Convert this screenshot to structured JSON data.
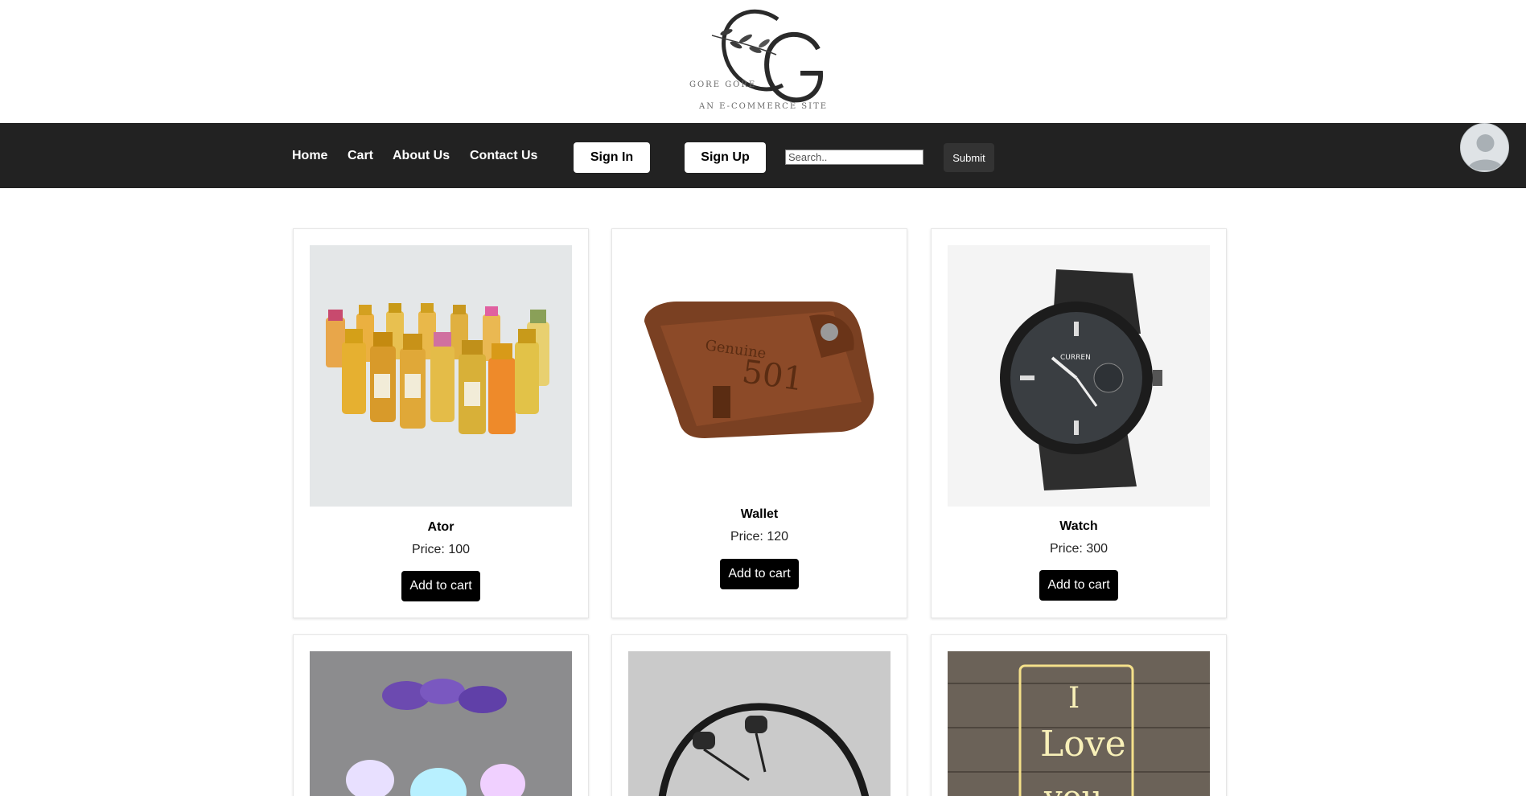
{
  "logo": {
    "brand_text": "GORE GORE",
    "tagline": "AN  E-COMMERCE SITE"
  },
  "nav": {
    "links": [
      "Home",
      "Cart",
      "About Us",
      "Contact Us"
    ],
    "sign_in": "Sign In",
    "sign_up": "Sign Up",
    "search_placeholder": "Search..",
    "submit": "Submit",
    "avatar_icon": "user-avatar-icon"
  },
  "products": [
    {
      "name": "Ator",
      "price": "Price: 100",
      "button": "Add to cart",
      "image": "perfume-bottles-image"
    },
    {
      "name": "Wallet",
      "price": "Price: 120",
      "button": "Add to cart",
      "image": "leather-wallet-image"
    },
    {
      "name": "Watch",
      "price": "Price: 300",
      "button": "Add to cart",
      "image": "wrist-watch-image"
    },
    {
      "name": "",
      "price": "",
      "button": "",
      "image": "mushroom-lamp-image"
    },
    {
      "name": "",
      "price": "",
      "button": "",
      "image": "neckband-earphones-image"
    },
    {
      "name": "",
      "price": "",
      "button": "",
      "image": "love-acrylic-lamp-image"
    }
  ],
  "colors": {
    "navbar": "#222222",
    "button_dark": "#000000",
    "submit": "#333333"
  }
}
